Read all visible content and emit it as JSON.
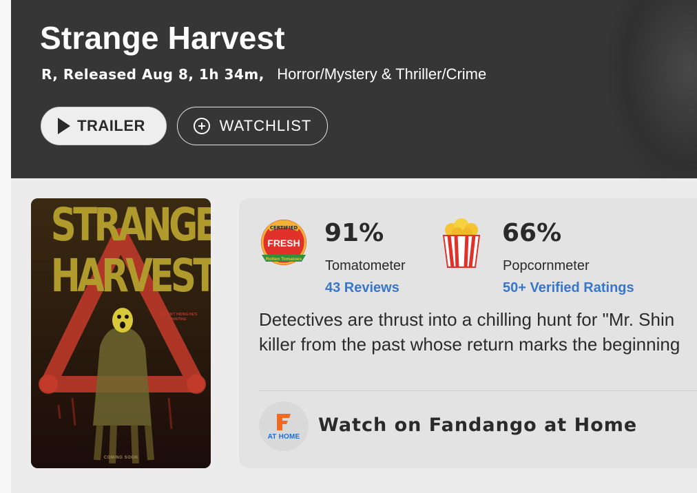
{
  "hero": {
    "title": "Strange Harvest",
    "release_info": "R, Released Aug 8, 1h 34m,",
    "genres": "Horror/Mystery & Thriller/Crime",
    "trailer_label": "TRAILER",
    "watchlist_label": "WATCHLIST"
  },
  "poster": {
    "title": "STRANGE HARVEST",
    "tagline": "HE ISN'T HIDING HE'S WAITING",
    "footer": "COMING SOON"
  },
  "scores": {
    "tomatometer": {
      "percent": "91%",
      "label": "Tomatometer",
      "reviews": "43 Reviews",
      "badge_certified": "CERTIFIED",
      "badge_fresh": "FRESH",
      "badge_brand": "Rotten Tomatoes"
    },
    "popcornmeter": {
      "percent": "66%",
      "label": "Popcornmeter",
      "ratings": "50+ Verified Ratings"
    }
  },
  "synopsis": {
    "line1": "Detectives are thrust into a chilling hunt for \"Mr. Shin",
    "line2": "killer from the past whose return marks the beginning"
  },
  "fandango": {
    "logo_text": "AT HOME",
    "cta": "Watch on Fandango at Home"
  },
  "colors": {
    "hero_bg": "#363636",
    "link_blue": "#3876c9",
    "fresh_red": "#e0322a",
    "poster_gold": "#b09a2c"
  }
}
